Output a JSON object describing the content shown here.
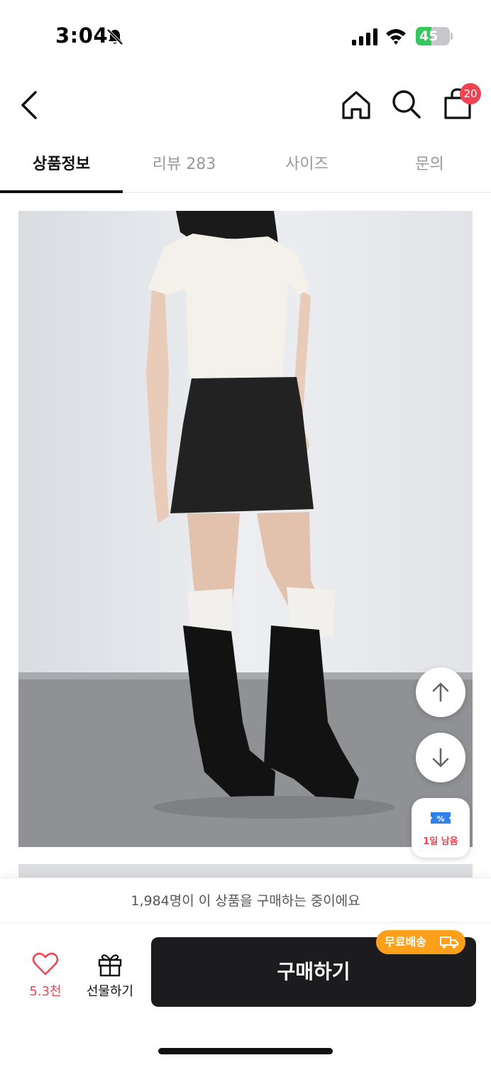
{
  "status_bar": {
    "time": "3:04",
    "battery_level": "45",
    "battery_fraction": 0.45
  },
  "header": {
    "cart_count": "20"
  },
  "tabs": [
    {
      "label": "상품정보",
      "active": true
    },
    {
      "label": "리뷰 283",
      "active": false
    },
    {
      "label": "사이즈",
      "active": false
    },
    {
      "label": "문의",
      "active": false
    }
  ],
  "coupon": {
    "label": "1일 남음"
  },
  "buying_notice": "1,984명이 이 상품을 구매하는 중이에요",
  "bottom_bar": {
    "like_count": "5.3천",
    "gift_label": "선물하기",
    "buy_label": "구매하기",
    "free_shipping_label": "무료배송"
  },
  "colors": {
    "accent_red": "#f04452",
    "buy_button": "#1c1c1e",
    "free_shipping": "#ff9f1a",
    "battery_green": "#34c759"
  },
  "icons": [
    "bell-off-icon",
    "signal-icon",
    "wifi-icon",
    "battery-icon",
    "back-arrow-icon",
    "home-icon",
    "search-icon",
    "shopping-bag-icon",
    "arrow-up-icon",
    "arrow-down-icon",
    "coupon-icon",
    "heart-icon",
    "gift-icon",
    "truck-icon"
  ]
}
